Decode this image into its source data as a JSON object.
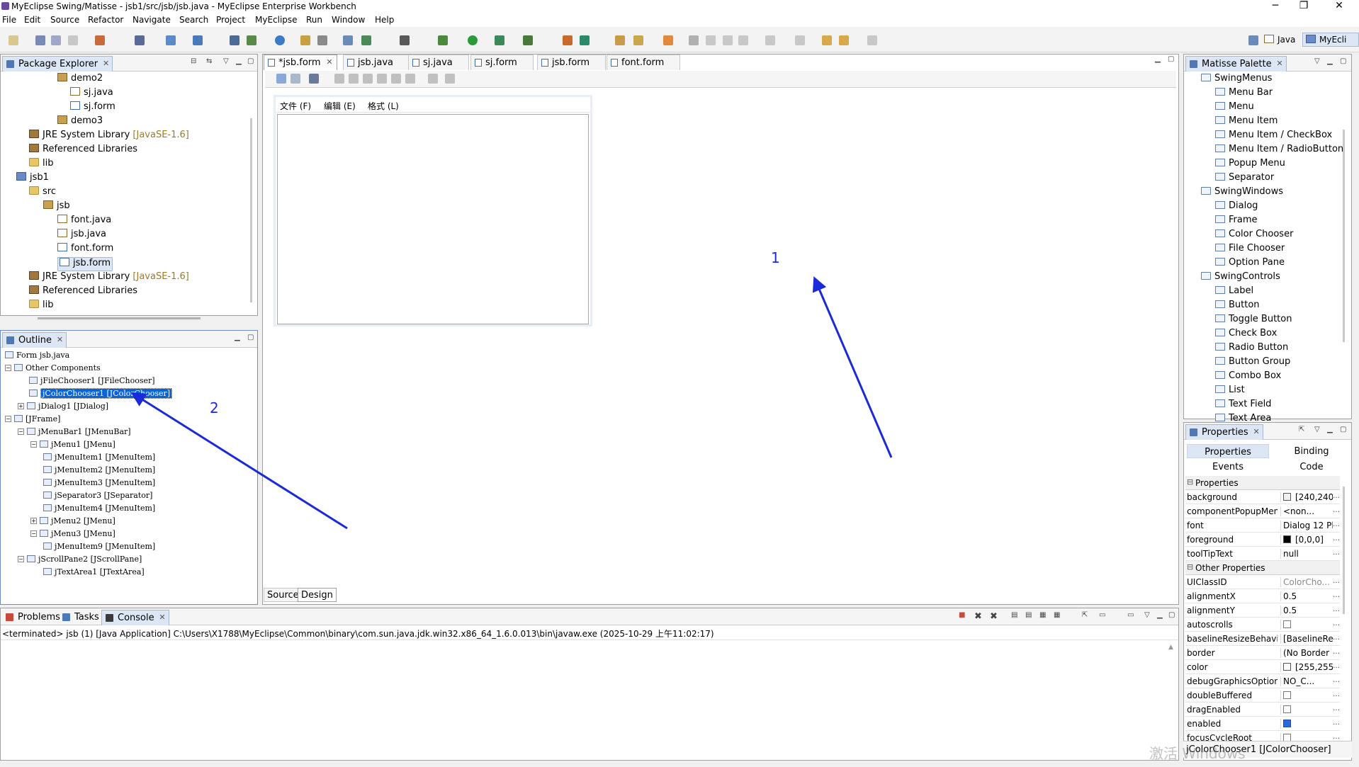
{
  "window": {
    "title": "MyEclipse Swing/Matisse - jsb1/src/jsb/jsb.java - MyEclipse Enterprise Workbench",
    "min": "─",
    "max": "❐",
    "close": "✕"
  },
  "menu": [
    "File",
    "Edit",
    "Source",
    "Refactor",
    "Navigate",
    "Search",
    "Project",
    "MyEclipse",
    "Run",
    "Window",
    "Help"
  ],
  "perspectives": {
    "java": "Java",
    "myeclipse": "MyEcli"
  },
  "package_explorer": {
    "title": "Package Explorer",
    "rows": [
      {
        "label": "demo2",
        "sub": "",
        "icon": "pkg"
      },
      {
        "label": "sj.java",
        "sub": "",
        "icon": "java"
      },
      {
        "label": "sj.form",
        "sub": "",
        "icon": "form"
      },
      {
        "label": "demo3",
        "sub": "",
        "icon": "pkg"
      },
      {
        "label": "JRE System Library ",
        "sub": "[JavaSE-1.6]",
        "icon": "lib"
      },
      {
        "label": "Referenced Libraries",
        "sub": "",
        "icon": "lib"
      },
      {
        "label": "lib",
        "sub": "",
        "icon": "folder"
      },
      {
        "label": "jsb1",
        "sub": "",
        "icon": "proj"
      },
      {
        "label": "src",
        "sub": "",
        "icon": "folder"
      },
      {
        "label": "jsb",
        "sub": "",
        "icon": "pkg"
      },
      {
        "label": "font.java",
        "sub": "",
        "icon": "java"
      },
      {
        "label": "jsb.java",
        "sub": "",
        "icon": "java"
      },
      {
        "label": "font.form",
        "sub": "",
        "icon": "form"
      },
      {
        "label": "jsb.form",
        "sub": "",
        "icon": "form"
      },
      {
        "label": "JRE System Library ",
        "sub": "[JavaSE-1.6]",
        "icon": "lib"
      },
      {
        "label": "Referenced Libraries",
        "sub": "",
        "icon": "lib"
      },
      {
        "label": "lib",
        "sub": "",
        "icon": "folder"
      }
    ]
  },
  "outline": {
    "title": "Outline",
    "rows": [
      "Form jsb.java",
      "Other Components",
      "jFileChooser1 [JFileChooser]",
      "jColorChooser1 [JColorChooser]",
      "jDialog1 [JDialog]",
      "[JFrame]",
      "jMenuBar1 [JMenuBar]",
      "jMenu1 [JMenu]",
      "jMenuItem1 [JMenuItem]",
      "jMenuItem2 [JMenuItem]",
      "jMenuItem3 [JMenuItem]",
      "jSeparator3 [JSeparator]",
      "jMenuItem4 [JMenuItem]",
      "jMenu2 [JMenu]",
      "jMenu3 [JMenu]",
      "jMenuItem9 [JMenuItem]",
      "jScrollPane2 [JScrollPane]",
      "jTextArea1 [JTextArea]"
    ]
  },
  "editor": {
    "tabs": [
      "*jsb.form",
      "jsb.java",
      "sj.java",
      "sj.form",
      "jsb.form",
      "font.form"
    ],
    "form_menus": [
      "文件 (F)",
      "编辑 (E)",
      "格式 (L)"
    ],
    "bottom_tabs": [
      "Source",
      "Design"
    ]
  },
  "annotations": {
    "arrow1": "1",
    "arrow2": "2"
  },
  "palette": {
    "title": "Matisse Palette",
    "groups": [
      {
        "name": "SwingMenus",
        "items": [
          "Menu Bar",
          "Menu",
          "Menu Item",
          "Menu Item / CheckBox",
          "Menu Item / RadioButton",
          "Popup Menu",
          "Separator"
        ]
      },
      {
        "name": "SwingWindows",
        "items": [
          "Dialog",
          "Frame",
          "Color Chooser",
          "File Chooser",
          "Option Pane"
        ]
      },
      {
        "name": "SwingControls",
        "items": [
          "Label",
          "Button",
          "Toggle Button",
          "Check Box",
          "Radio Button",
          "Button Group",
          "Combo Box",
          "List",
          "Text Field",
          "Text Area"
        ]
      }
    ]
  },
  "properties": {
    "title": "Properties",
    "tabs": [
      "Properties",
      "Binding",
      "Events",
      "Code"
    ],
    "section1": "Properties",
    "rows1": [
      {
        "name": "background",
        "value": "[240,240",
        "swatch": "#f0f0f0"
      },
      {
        "name": "componentPopupMen",
        "value": "<non...",
        "swatch": ""
      },
      {
        "name": "font",
        "value": "Dialog 12 Pl",
        "swatch": ""
      },
      {
        "name": "foreground",
        "value": "[0,0,0]",
        "swatch": "#000000"
      },
      {
        "name": "toolTipText",
        "value": "null",
        "swatch": ""
      }
    ],
    "section2": "Other Properties",
    "rows2": [
      {
        "name": "UIClassID",
        "value": "ColorCho...",
        "type": "text"
      },
      {
        "name": "alignmentX",
        "value": "0.5",
        "type": "text"
      },
      {
        "name": "alignmentY",
        "value": "0.5",
        "type": "text"
      },
      {
        "name": "autoscrolls",
        "value": "",
        "type": "check"
      },
      {
        "name": "baselineResizeBehavic",
        "value": "[BaselineResiz",
        "type": "text"
      },
      {
        "name": "border",
        "value": "(No Border",
        "type": "text"
      },
      {
        "name": "color",
        "value": "[255,255",
        "type": "swatch"
      },
      {
        "name": "debugGraphicsOption",
        "value": "NO_C...",
        "type": "text"
      },
      {
        "name": "doubleBuffered",
        "value": "",
        "type": "check"
      },
      {
        "name": "dragEnabled",
        "value": "",
        "type": "check"
      },
      {
        "name": "enabled",
        "value": "",
        "type": "checked"
      },
      {
        "name": "focusCycleRoot",
        "value": "",
        "type": "check"
      }
    ],
    "status": "jColorChooser1 [JColorChooser]"
  },
  "console": {
    "tabs": [
      "Problems",
      "Tasks",
      "Console"
    ],
    "text": "<terminated> jsb (1) [Java Application] C:\\Users\\X1788\\MyEclipse\\Common\\binary\\com.sun.java.jdk.win32.x86_64_1.6.0.013\\bin\\javaw.exe (2025-10-29 上午11:02:17)"
  },
  "watermark": "激活 Windows"
}
